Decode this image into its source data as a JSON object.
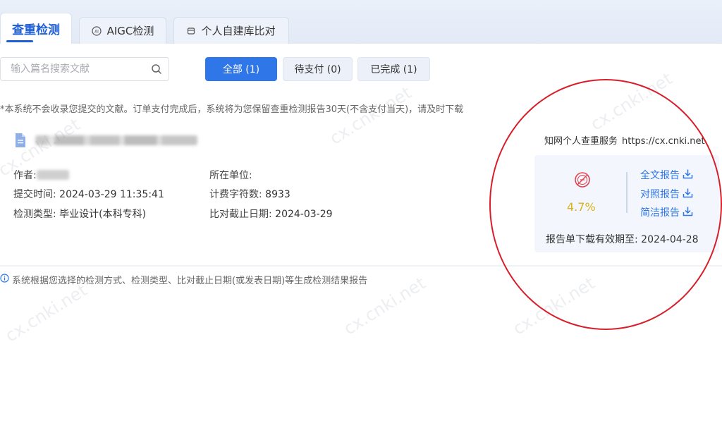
{
  "tabs": [
    {
      "label": "查重检测",
      "icon": "",
      "active": true
    },
    {
      "label": "AIGC检测",
      "icon": "ai-icon",
      "active": false
    },
    {
      "label": "个人自建库比对",
      "icon": "library-icon",
      "active": false
    }
  ],
  "search": {
    "placeholder": "输入篇名搜索文献",
    "value": ""
  },
  "filters": [
    {
      "label": "全部 (1)",
      "active": true
    },
    {
      "label": "待支付 (0)",
      "active": false
    },
    {
      "label": "已完成 (1)",
      "active": false
    }
  ],
  "notice": "*本系统不会收录您提交的文献。订单支付完成后，系统将为您保留查重检测报告30天(不含支付当天)，请及时下载",
  "record": {
    "author_label": "作者:",
    "submit_time_label": "提交时间:",
    "submit_time": "2024-03-29 11:35:41",
    "check_type_label": "检测类型:",
    "check_type": "毕业设计(本科专科)",
    "unit_label": "所在单位:",
    "char_count_label": "计费字符数:",
    "char_count": "8933",
    "cutoff_label": "比对截止日期:",
    "cutoff_date": "2024-03-29"
  },
  "report": {
    "service_name": "知网个人查重服务",
    "service_url": "https://cx.cnki.net",
    "percent": "4.7%",
    "links": [
      "全文报告",
      "对照报告",
      "简洁报告"
    ],
    "expire_label": "报告单下载有效期至:",
    "expire_date": "2024-04-28"
  },
  "footnote": "系统根据您选择的检测方式、检测类型、比对截止日期(或发表日期)等生成检测结果报告",
  "watermark": "cx.cnki.net",
  "colors": {
    "primary": "#2f76e8",
    "percent": "#d9b21a",
    "annotation": "#d81e2a"
  }
}
